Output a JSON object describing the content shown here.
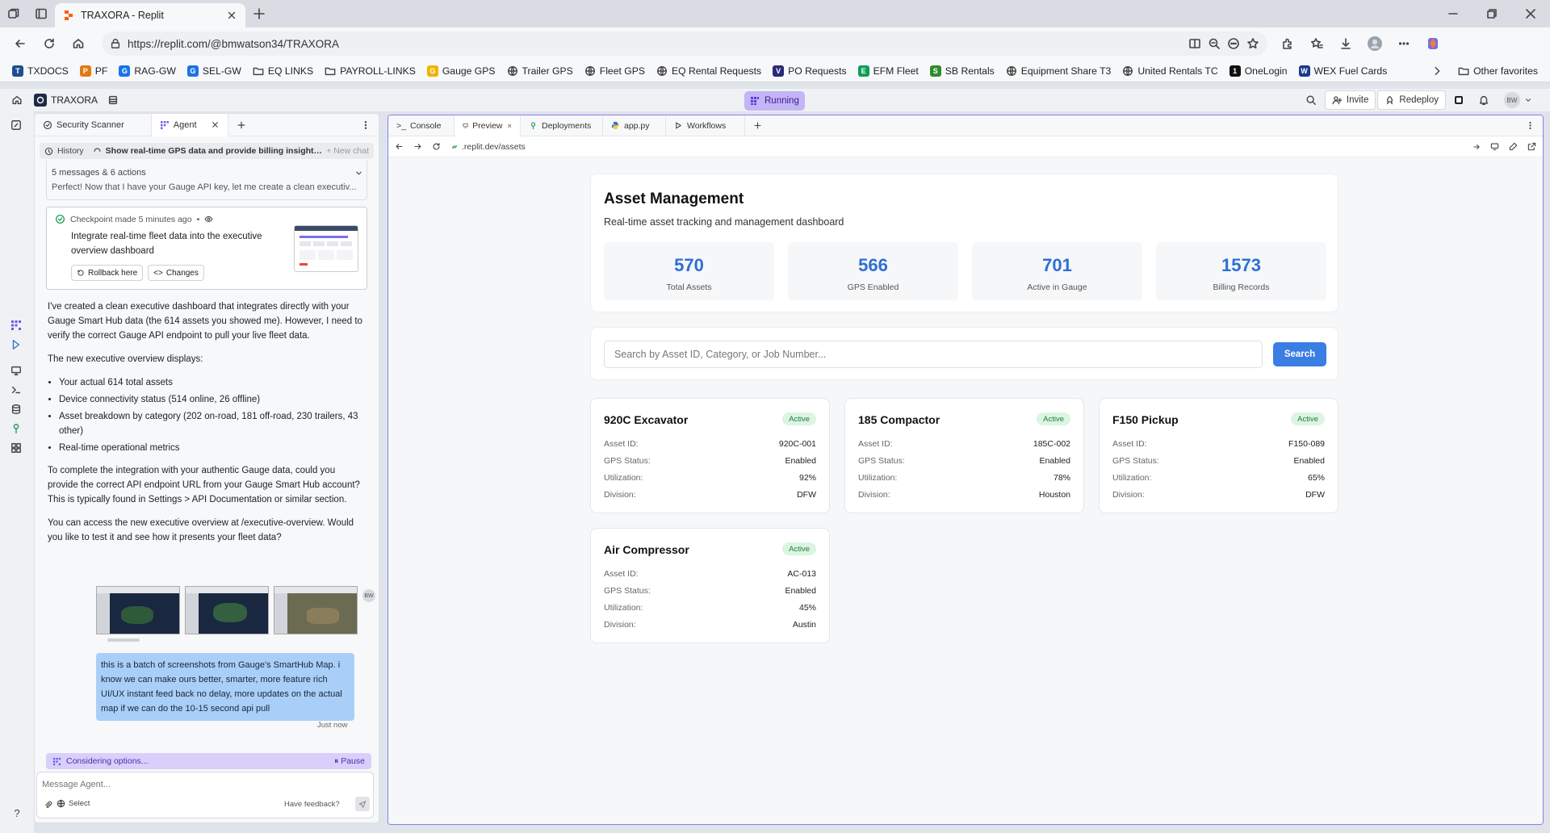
{
  "browser": {
    "tab_title": "TRAXORA - Replit",
    "url": "https://replit.com/@bmwatson34/TRAXORA",
    "favorites": [
      {
        "label": "TXDOCS",
        "color": "#1d4f91",
        "icon": "T"
      },
      {
        "label": "PF",
        "color": "#e07a14",
        "icon": "P"
      },
      {
        "label": "RAG-GW",
        "color": "#1a73e8",
        "icon": "G"
      },
      {
        "label": "SEL-GW",
        "color": "#1a73e8",
        "icon": "G"
      },
      {
        "label": "EQ LINKS",
        "color": "folder",
        "icon": ""
      },
      {
        "label": "PAYROLL-LINKS",
        "color": "folder",
        "icon": ""
      },
      {
        "label": "Gauge GPS",
        "color": "#f0b400",
        "icon": "G"
      },
      {
        "label": "Trailer GPS",
        "color": "globe",
        "icon": ""
      },
      {
        "label": "Fleet GPS",
        "color": "globe",
        "icon": ""
      },
      {
        "label": "EQ Rental Requests",
        "color": "globe",
        "icon": ""
      },
      {
        "label": "PO Requests",
        "color": "#2a2a7a",
        "icon": "V"
      },
      {
        "label": "EFM Fleet",
        "color": "#0f9d58",
        "icon": "E"
      },
      {
        "label": "SB Rentals",
        "color": "#2e8b2e",
        "icon": "S"
      },
      {
        "label": "Equipment Share T3",
        "color": "globe",
        "icon": ""
      },
      {
        "label": "United Rentals TC",
        "color": "globe",
        "icon": ""
      },
      {
        "label": "OneLogin",
        "color": "#111111",
        "icon": "1"
      },
      {
        "label": "WEX Fuel Cards",
        "color": "#1d3a8a",
        "icon": "W"
      }
    ],
    "other_favorites": "Other favorites"
  },
  "replit": {
    "project_name": "TRAXORA",
    "status": "Running",
    "invite_label": "Invite",
    "redeploy_label": "Redeploy",
    "avatar_initials": "BW"
  },
  "agent_panel": {
    "tabs": [
      "Security Scanner",
      "Agent"
    ],
    "history_label": "History",
    "history_title": "Show real-time GPS data and provide billing insights on a ne...",
    "new_chat": "New chat",
    "summary_count": "5 messages & 6 actions",
    "summary_preview": "Perfect! Now that I have your Gauge API key, let me create a clean executiv...",
    "checkpoint": {
      "made": "Checkpoint made 5 minutes ago",
      "title": "Integrate real-time fleet data into the executive overview dashboard",
      "rollback": "Rollback here",
      "changes": "Changes"
    },
    "message": {
      "p1": "I've created a clean executive dashboard that integrates directly with your Gauge Smart Hub data (the 614 assets you showed me). However, I need to verify the correct Gauge API endpoint to pull your live fleet data.",
      "p2": "The new executive overview displays:",
      "bullets": [
        "Your actual 614 total assets",
        "Device connectivity status (514 online, 26 offline)",
        "Asset breakdown by category (202 on-road, 181 off-road, 230 trailers, 43 other)",
        "Real-time operational metrics"
      ],
      "p3": "To complete the integration with your authentic Gauge data, could you provide the correct API endpoint URL from your Gauge Smart Hub account? This is typically found in Settings > API Documentation or similar section.",
      "p4": "You can access the new executive overview at /executive-overview. Would you like to test it and see how it presents your fleet data?"
    },
    "user_message": "this is a batch of screenshots from Gauge's SmartHub Map. i know we can make ours better, smarter, more feature rich UI/UX instant feed back no delay, more updates on the actual map if we can do the 10-15 second api pull",
    "user_time": "Just now",
    "user_initials": "BW",
    "considering": "Considering options...",
    "pause": "Pause",
    "input_placeholder": "Message Agent...",
    "select_label": "Select",
    "feedback": "Have feedback?"
  },
  "preview_panel": {
    "tabs": [
      "Console",
      "Preview",
      "Deployments",
      "app.py",
      "Workflows"
    ],
    "path": ".replit.dev/assets"
  },
  "dashboard": {
    "title": "Asset Management",
    "subtitle": "Real-time asset tracking and management dashboard",
    "stats": [
      {
        "value": "570",
        "label": "Total Assets"
      },
      {
        "value": "566",
        "label": "GPS Enabled"
      },
      {
        "value": "701",
        "label": "Active in Gauge"
      },
      {
        "value": "1573",
        "label": "Billing Records"
      }
    ],
    "search_placeholder": "Search by Asset ID, Category, or Job Number...",
    "search_button": "Search",
    "field_labels": {
      "asset_id": "Asset ID:",
      "gps": "GPS Status:",
      "util": "Utilization:",
      "division": "Division:"
    },
    "assets": [
      {
        "name": "920C Excavator",
        "status": "Active",
        "asset_id": "920C-001",
        "gps": "Enabled",
        "util": "92%",
        "division": "DFW"
      },
      {
        "name": "185 Compactor",
        "status": "Active",
        "asset_id": "185C-002",
        "gps": "Enabled",
        "util": "78%",
        "division": "Houston"
      },
      {
        "name": "F150 Pickup",
        "status": "Active",
        "asset_id": "F150-089",
        "gps": "Enabled",
        "util": "65%",
        "division": "DFW"
      },
      {
        "name": "Air Compressor",
        "status": "Active",
        "asset_id": "AC-013",
        "gps": "Enabled",
        "util": "45%",
        "division": "Austin"
      }
    ]
  },
  "colors": {
    "accent": "#3a7ee4",
    "running_bg": "#c4b5f7",
    "user_bubble": "#a9cff8",
    "active_badge": "#dcf5e3"
  }
}
